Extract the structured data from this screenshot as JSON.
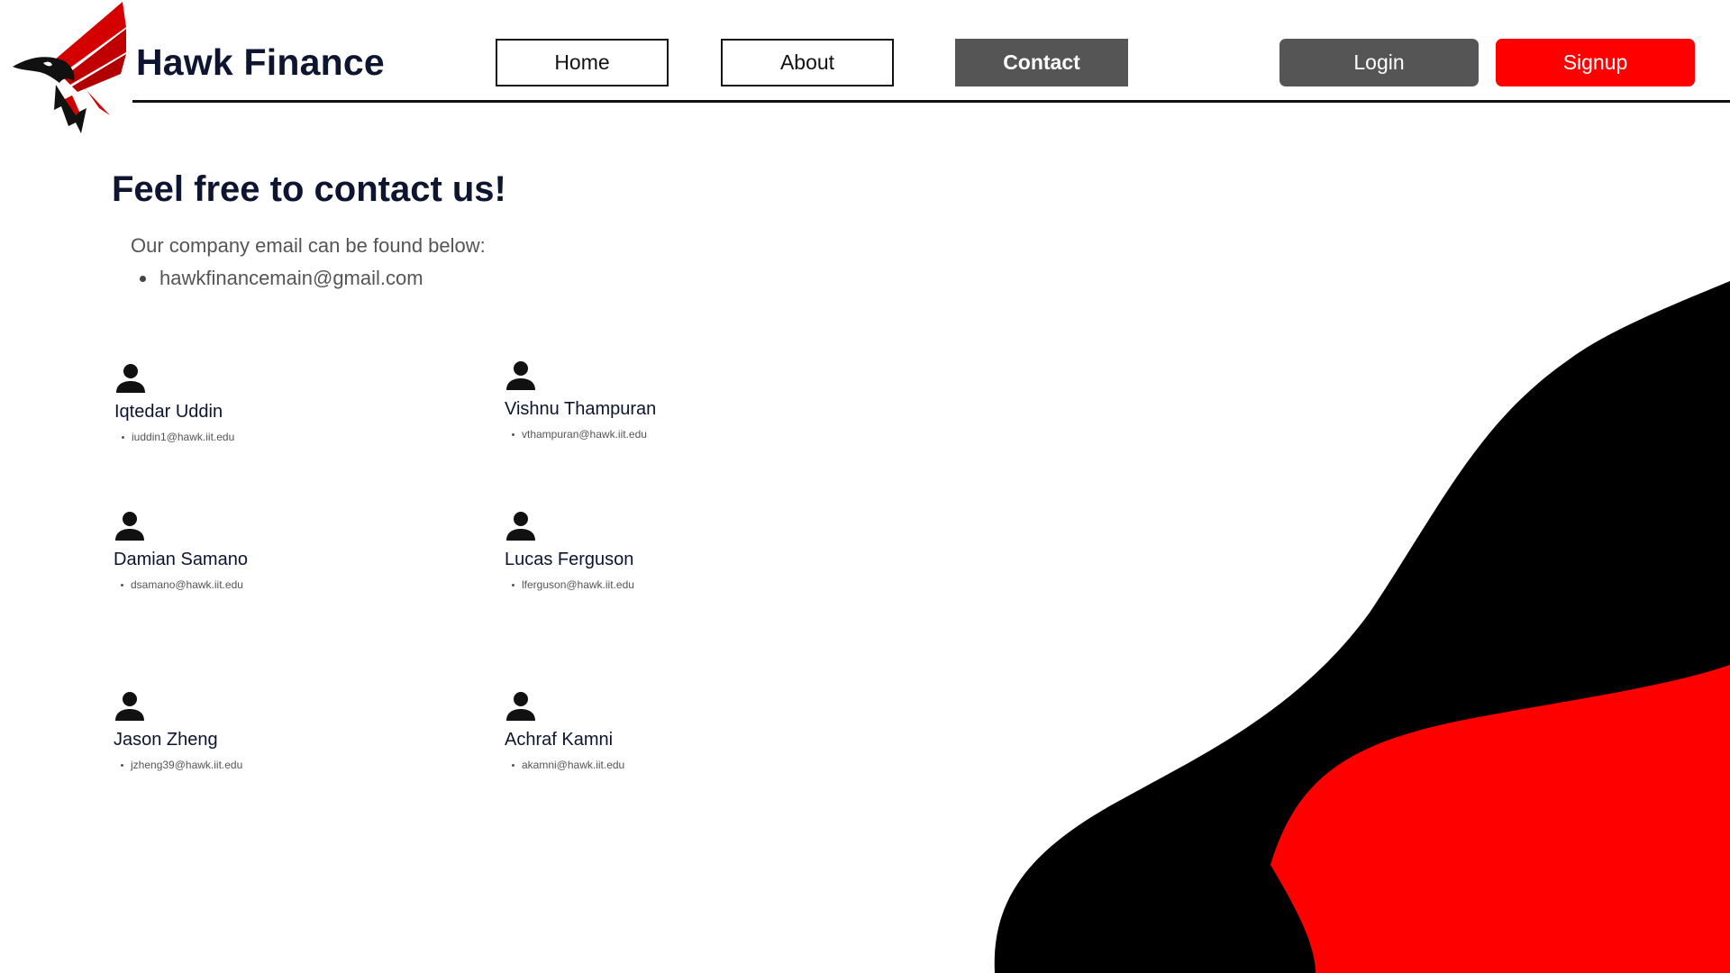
{
  "brand": {
    "name": "Hawk Finance",
    "logo": "hawk-logo-icon"
  },
  "nav": {
    "home_label": "Home",
    "about_label": "About",
    "contact_label": "Contact",
    "login_label": "Login",
    "signup_label": "Signup",
    "active": "Contact"
  },
  "contact": {
    "title": "Feel free to contact us!",
    "intro": "Our company email can be found below:",
    "company_email": "hawkfinancemain@gmail.com"
  },
  "team": [
    {
      "name": "Iqtedar Uddin",
      "email": "iuddin1@hawk.iit.edu",
      "icon": "person-icon"
    },
    {
      "name": "Vishnu Thampuran",
      "email": "vthampuran@hawk.iit.edu",
      "icon": "person-icon"
    },
    {
      "name": "Damian Samano",
      "email": "dsamano@hawk.iit.edu",
      "icon": "person-icon"
    },
    {
      "name": "Lucas Ferguson",
      "email": "lferguson@hawk.iit.edu",
      "icon": "person-icon"
    },
    {
      "name": "Jason Zheng",
      "email": "jzheng39@hawk.iit.edu",
      "icon": "person-icon"
    },
    {
      "name": "Achraf Kamni",
      "email": "akamni@hawk.iit.edu",
      "icon": "person-icon"
    }
  ],
  "colors": {
    "accent": "#ff0000",
    "dark_button": "#555555",
    "heading": "#0d1531",
    "blob_dark": "#000000",
    "blob_accent": "#ff0000"
  }
}
